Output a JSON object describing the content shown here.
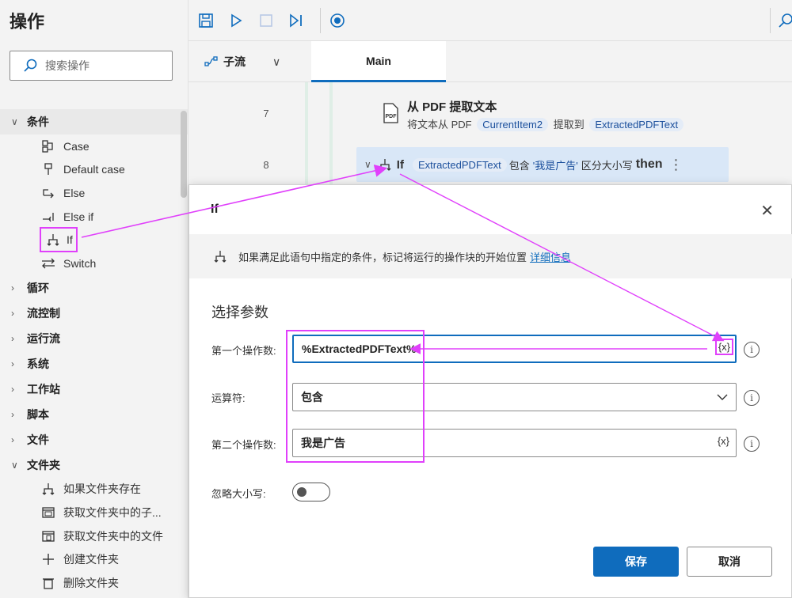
{
  "left_panel": {
    "title": "操作",
    "search_placeholder": "搜索操作",
    "categories": [
      {
        "label": "条件",
        "expanded": true,
        "items": [
          {
            "label": "Case",
            "icon": "case-icon"
          },
          {
            "label": "Default case",
            "icon": "default-case-icon"
          },
          {
            "label": "Else",
            "icon": "else-icon"
          },
          {
            "label": "Else if",
            "icon": "else-if-icon"
          },
          {
            "label": "If",
            "icon": "if-icon"
          },
          {
            "label": "Switch",
            "icon": "switch-icon"
          }
        ]
      },
      {
        "label": "循环"
      },
      {
        "label": "流控制"
      },
      {
        "label": "运行流"
      },
      {
        "label": "系统"
      },
      {
        "label": "工作站"
      },
      {
        "label": "脚本"
      },
      {
        "label": "文件"
      },
      {
        "label": "文件夹",
        "expanded": true,
        "items": [
          {
            "label": "如果文件夹存在",
            "icon": "if-icon"
          },
          {
            "label": "获取文件夹中的子...",
            "icon": "folder-sub-icon"
          },
          {
            "label": "获取文件夹中的文件",
            "icon": "folder-files-icon"
          },
          {
            "label": "创建文件夹",
            "icon": "plus-icon"
          },
          {
            "label": "删除文件夹",
            "icon": "trash-icon"
          }
        ]
      }
    ]
  },
  "tabs": {
    "subflow_label": "子流",
    "main_label": "Main"
  },
  "flow": {
    "steps": [
      {
        "line": "7",
        "title": "从 PDF 提取文本",
        "desc_prefix": "将文本从 PDF",
        "var1": "CurrentItem2",
        "desc_mid": "提取到",
        "var2": "ExtractedPDFText"
      },
      {
        "line": "8",
        "keyword": "If",
        "var": "ExtractedPDFText",
        "op": "包含",
        "value": "'我是广告'",
        "suffix": "区分大小写",
        "then": "then"
      }
    ]
  },
  "dialog": {
    "title": "If",
    "info_text": "如果满足此语句中指定的条件，标记将运行的操作块的开始位置",
    "info_link": "详细信息",
    "section": "选择参数",
    "first_operand_label": "第一个操作数:",
    "first_operand_value": "%ExtractedPDFText%",
    "operator_label": "运算符:",
    "operator_value": "包含",
    "second_operand_label": "第二个操作数:",
    "second_operand_value": "我是广告",
    "ignore_case_label": "忽略大小写:",
    "ignore_case_on": false,
    "var_button": "{x}",
    "info_glyph": "i",
    "close_glyph": "✕",
    "save": "保存",
    "cancel": "取消"
  },
  "colors": {
    "accent": "#0f6cbd",
    "annotation": "#e040fb",
    "chip_bg": "#e4ecf7"
  }
}
